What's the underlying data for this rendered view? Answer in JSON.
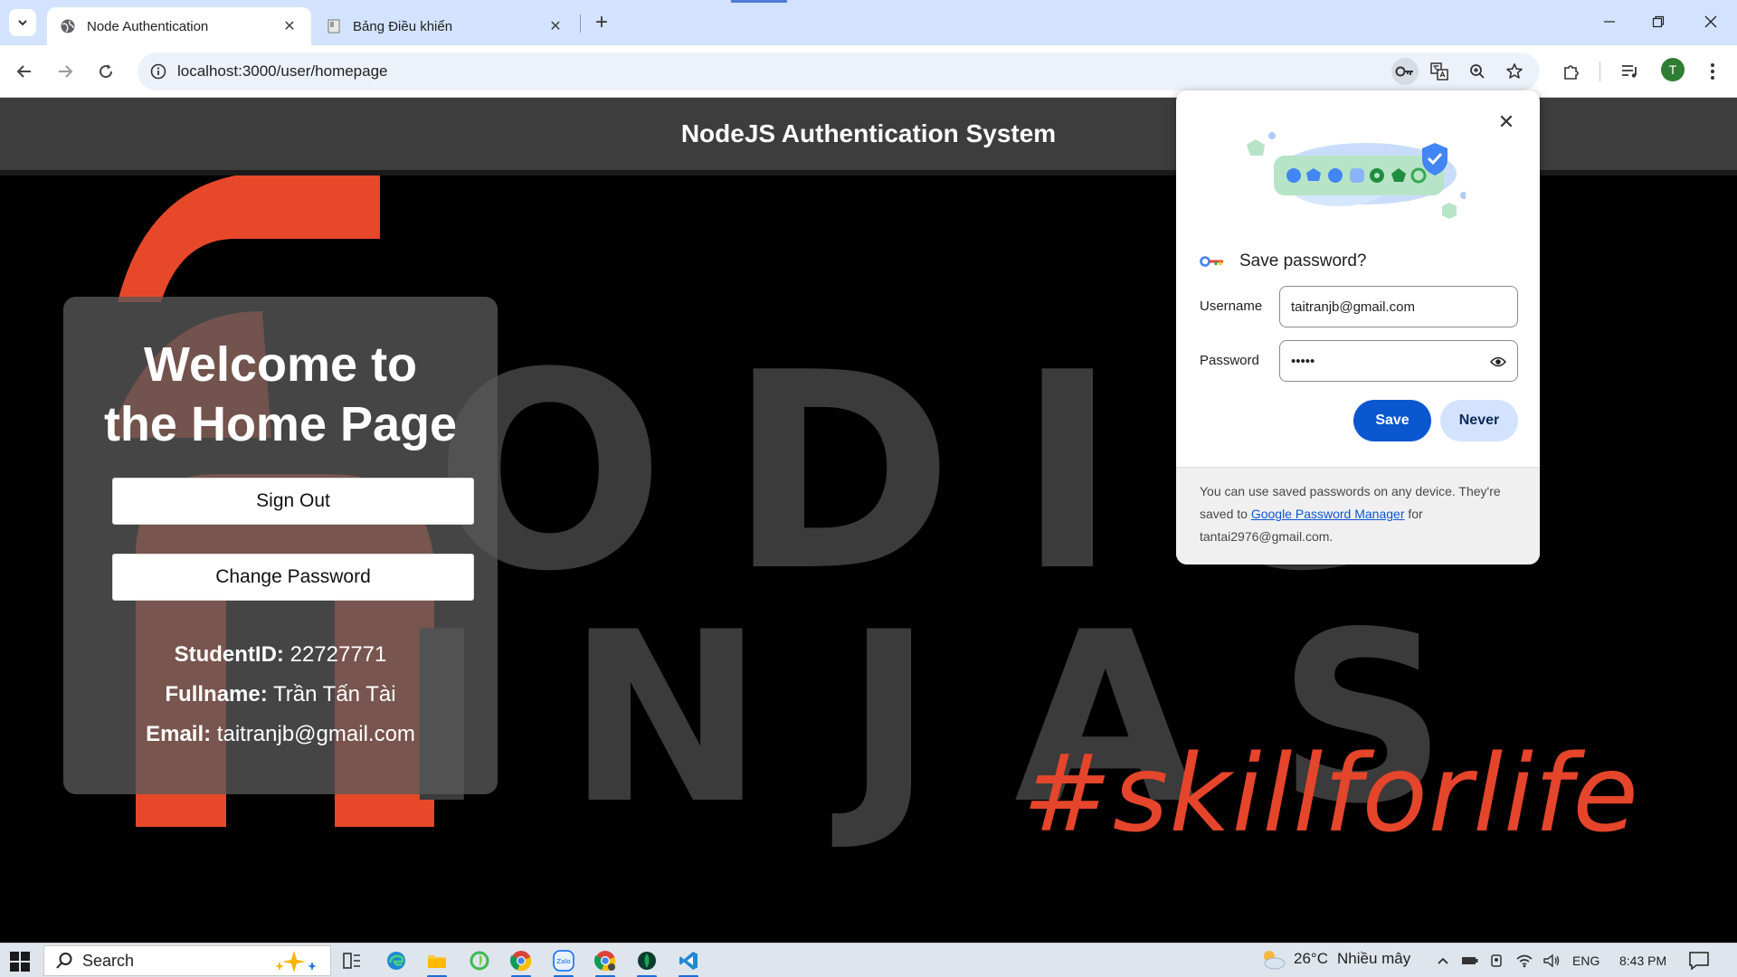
{
  "browser": {
    "tabs": [
      {
        "title": "Node Authentication",
        "active": true
      },
      {
        "title": "Bảng Điều khiển",
        "active": false
      }
    ],
    "url": "localhost:3000/user/homepage",
    "profile_initial": "T"
  },
  "page": {
    "header_title": "NodeJS Authentication System",
    "background_letters": [
      "ODIG",
      "INJAS"
    ],
    "tagline": "#skillforlife",
    "welcome_title_line1": "Welcome to",
    "welcome_title_line2": "the Home Page",
    "sign_out_label": "Sign Out",
    "change_password_label": "Change Password",
    "student_id_label": "StudentID:",
    "student_id_value": "22727771",
    "fullname_label": "Fullname:",
    "fullname_value": "Trần Tấn Tài",
    "email_label": "Email:",
    "email_value": "taitranjb@gmail.com"
  },
  "password_bubble": {
    "title": "Save password?",
    "username_label": "Username",
    "username_value": "taitranjb@gmail.com",
    "password_label": "Password",
    "password_masked": "•••••",
    "save_label": "Save",
    "never_label": "Never",
    "footer_text_1": "You can use saved passwords on any device. They're saved to",
    "footer_link": "Google Password Manager",
    "footer_text_2": "for",
    "footer_account": "tantai2976@gmail.com."
  },
  "taskbar": {
    "search_placeholder": "Search",
    "weather_temp": "26°C",
    "weather_desc": "Nhiều mây",
    "language": "ENG",
    "time": "8:43 PM"
  },
  "colors": {
    "brand_orange": "#e5452a",
    "chrome_blue": "#0b57d0",
    "header_bg": "#3d3d3d"
  }
}
